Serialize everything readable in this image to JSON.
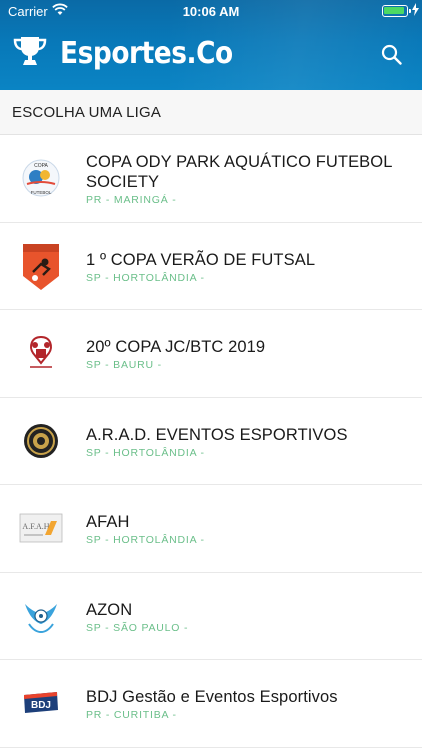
{
  "status_bar": {
    "carrier": "Carrier",
    "time": "10:06 AM"
  },
  "header": {
    "title": "Esportes.Co",
    "logo_icon": "trophy-icon",
    "search_icon": "search-icon"
  },
  "section": {
    "title": "ESCOLHA UMA LIGA"
  },
  "colors": {
    "header": "#0878b8",
    "location": "#6bbf8a",
    "battery": "#4cd964"
  },
  "leagues": [
    {
      "name": "COPA ODY PARK AQUÁTICO FUTEBOL SOCIETY",
      "location": "PR - MARINGÁ -",
      "logo": "copa-ody-park-logo"
    },
    {
      "name": "1 º COPA VERÃO DE FUTSAL",
      "location": "SP - HORTOLÂNDIA -",
      "logo": "copa-verao-logo"
    },
    {
      "name": "20º COPA JC/BTC 2019",
      "location": "SP - BAURU -",
      "logo": "copa-jc-btc-logo"
    },
    {
      "name": "A.R.A.D. EVENTOS ESPORTIVOS",
      "location": "SP - HORTOLÂNDIA -",
      "logo": "arad-logo"
    },
    {
      "name": "AFAH",
      "location": "SP - HORTOLÂNDIA -",
      "logo": "afah-logo",
      "logo_text": "A.F.A.H."
    },
    {
      "name": "AZON",
      "location": "SP - SÃO PAULO -",
      "logo": "azon-logo"
    },
    {
      "name": "BDJ Gestão e Eventos Esportivos",
      "location": "PR - CURITIBA -",
      "logo": "bdj-logo",
      "logo_text": "BDJ"
    }
  ]
}
